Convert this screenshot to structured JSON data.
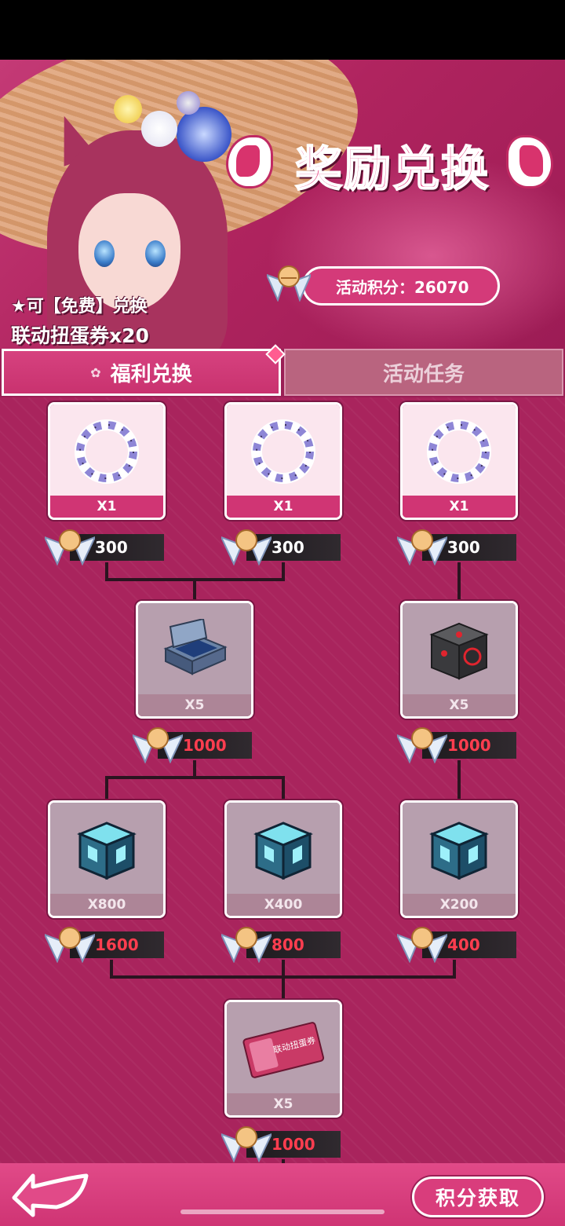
{
  "banner": {
    "title": "奖励兑换",
    "points_label": "活动积分：26070",
    "promo_line1": "★可【免费】兑换",
    "promo_line2": "联动扭蛋券x20"
  },
  "tabs": [
    {
      "label": "福利兑换",
      "active": true
    },
    {
      "label": "活动任务",
      "active": false
    }
  ],
  "rewards": [
    {
      "icon": "flower-wreath-icon",
      "qty": "X1",
      "cost": "300",
      "cost_color": "white"
    },
    {
      "icon": "flower-wreath-icon",
      "qty": "X1",
      "cost": "300",
      "cost_color": "white"
    },
    {
      "icon": "flower-wreath-icon",
      "qty": "X1",
      "cost": "300",
      "cost_color": "white"
    },
    {
      "icon": "supply-case-icon",
      "qty": "X5",
      "cost": "1000",
      "cost_color": "red"
    },
    {
      "icon": "tech-crate-icon",
      "qty": "X5",
      "cost": "1000",
      "cost_color": "red"
    },
    {
      "icon": "cyan-cube-icon",
      "qty": "X800",
      "cost": "1600",
      "cost_color": "red"
    },
    {
      "icon": "cyan-cube-icon",
      "qty": "X400",
      "cost": "800",
      "cost_color": "red"
    },
    {
      "icon": "cyan-cube-icon",
      "qty": "X200",
      "cost": "400",
      "cost_color": "red"
    },
    {
      "icon": "gacha-ticket-icon",
      "qty": "X5",
      "cost": "1000",
      "cost_color": "red",
      "ticket_text": "联动扭蛋券"
    }
  ],
  "footer": {
    "earn_label": "积分获取"
  },
  "colors": {
    "accent": "#d43a79",
    "background": "#a9245d",
    "cost_red": "#ff3d4f"
  }
}
